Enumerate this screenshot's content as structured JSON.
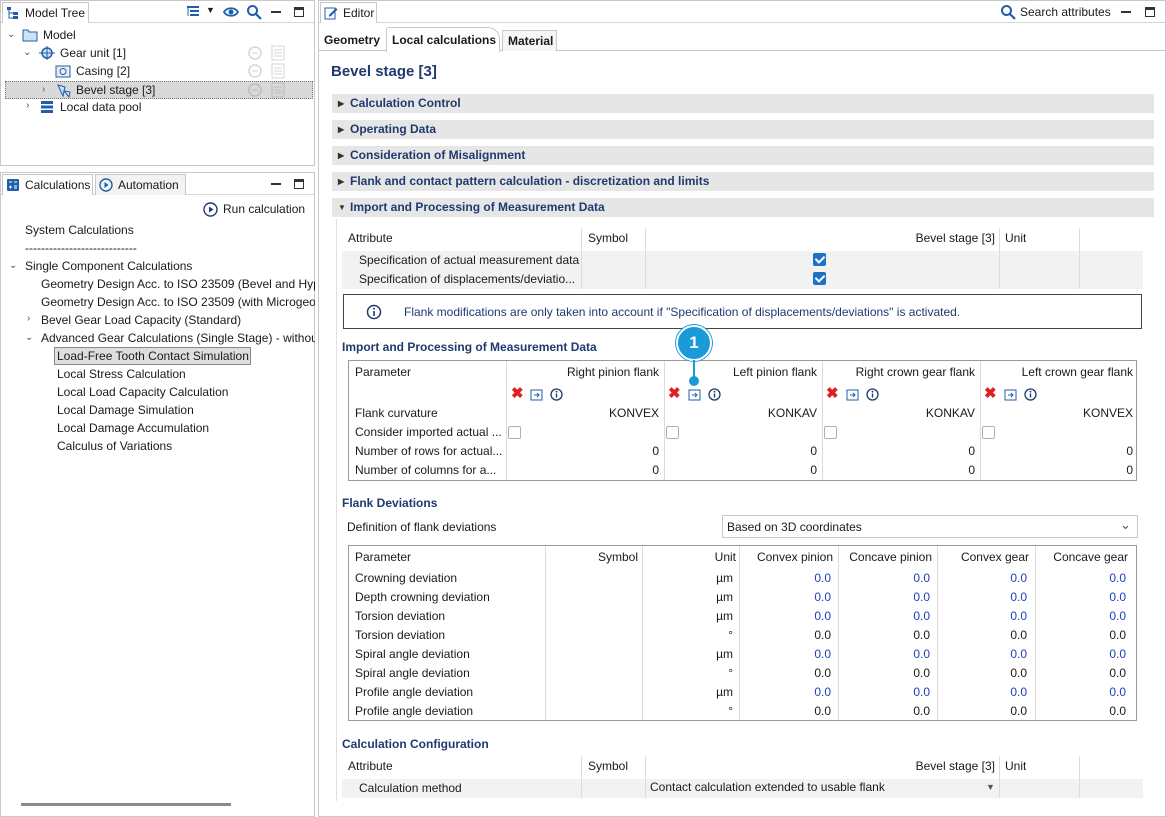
{
  "model_tree": {
    "tab_label": "Model Tree",
    "items": [
      {
        "label": "Model"
      },
      {
        "label": "Gear unit [1]"
      },
      {
        "label": "Casing [2]"
      },
      {
        "label": "Bevel stage [3]"
      },
      {
        "label": "Local data pool"
      }
    ]
  },
  "calc_panel": {
    "tabs": [
      "Calculations",
      "Automation"
    ],
    "run_label": "Run calculation",
    "items": [
      "System Calculations",
      "----------------------------",
      "Single Component Calculations",
      "Geometry Design Acc. to ISO 23509 (Bevel and Hypc",
      "Geometry Design Acc. to ISO 23509 (with Microgeor",
      "Bevel Gear Load Capacity (Standard)",
      "Advanced Gear Calculations (Single Stage) - withou",
      "Load-Free Tooth Contact Simulation",
      "Local Stress Calculation",
      "Local Load Capacity Calculation",
      "Local Damage Simulation",
      "Local Damage Accumulation",
      "Calculus of Variations"
    ]
  },
  "editor": {
    "tab_label": "Editor",
    "search_label": "Search attributes",
    "sub_tabs": [
      "Geometry",
      "Local calculations",
      "Material"
    ],
    "title": "Bevel stage [3]",
    "sections": [
      "Calculation Control",
      "Operating Data",
      "Consideration of Misalignment",
      "Flank and contact pattern calculation - discretization and limits",
      "Import and Processing of Measurement Data"
    ],
    "attr_table": {
      "headers": [
        "Attribute",
        "Symbol",
        "Bevel stage [3]",
        "Unit"
      ],
      "rows": [
        "Specification of actual measurement data",
        "Specification of displacements/deviatio..."
      ]
    },
    "info_text": "Flank modifications are only taken into account if \"Specification of displacements/deviations\" is activated.",
    "measurement": {
      "title": "Import and Processing of Measurement Data",
      "callout": "1",
      "headers": [
        "Parameter",
        "Right pinion flank",
        "Left pinion flank",
        "Right crown gear flank",
        "Left crown gear flank"
      ],
      "rows": [
        {
          "label": "Flank curvature",
          "values": [
            "KONVEX",
            "KONKAV",
            "KONKAV",
            "KONVEX"
          ]
        },
        {
          "label": "Consider imported actual ...",
          "values": [
            "",
            "",
            "",
            ""
          ]
        },
        {
          "label": "Number of rows for actual...",
          "values": [
            "0",
            "0",
            "0",
            "0"
          ]
        },
        {
          "label": "Number of columns for a...",
          "values": [
            "0",
            "0",
            "0",
            "0"
          ]
        }
      ]
    },
    "flank_dev": {
      "title": "Flank Deviations",
      "def_label": "Definition of flank deviations",
      "def_value": "Based on 3D coordinates",
      "headers": [
        "Parameter",
        "Symbol",
        "Unit",
        "Convex pinion",
        "Concave pinion",
        "Convex gear",
        "Concave gear"
      ],
      "rows": [
        {
          "label": "Crowning deviation",
          "unit": "µm",
          "values": [
            "0.0",
            "0.0",
            "0.0",
            "0.0"
          ],
          "editable": true
        },
        {
          "label": "Depth crowning deviation",
          "unit": "µm",
          "values": [
            "0.0",
            "0.0",
            "0.0",
            "0.0"
          ],
          "editable": true
        },
        {
          "label": "Torsion deviation",
          "unit": "µm",
          "values": [
            "0.0",
            "0.0",
            "0.0",
            "0.0"
          ],
          "editable": true
        },
        {
          "label": "Torsion deviation",
          "unit": "°",
          "values": [
            "0.0",
            "0.0",
            "0.0",
            "0.0"
          ],
          "editable": false
        },
        {
          "label": "Spiral angle deviation",
          "unit": "µm",
          "values": [
            "0.0",
            "0.0",
            "0.0",
            "0.0"
          ],
          "editable": true
        },
        {
          "label": "Spiral angle deviation",
          "unit": "°",
          "values": [
            "0.0",
            "0.0",
            "0.0",
            "0.0"
          ],
          "editable": false
        },
        {
          "label": "Profile angle deviation",
          "unit": "µm",
          "values": [
            "0.0",
            "0.0",
            "0.0",
            "0.0"
          ],
          "editable": true
        },
        {
          "label": "Profile angle deviation",
          "unit": "°",
          "values": [
            "0.0",
            "0.0",
            "0.0",
            "0.0"
          ],
          "editable": false
        }
      ]
    },
    "calc_config": {
      "title": "Calculation Configuration",
      "headers": [
        "Attribute",
        "Symbol",
        "Bevel stage [3]",
        "Unit"
      ],
      "row_label": "Calculation method",
      "row_value": "Contact calculation extended to usable flank"
    }
  },
  "colors": {
    "accent": "#1f3a6e",
    "link_value": "#1a3fbf",
    "callout": "#1a9bd7",
    "checkbox": "#1a73c7"
  }
}
